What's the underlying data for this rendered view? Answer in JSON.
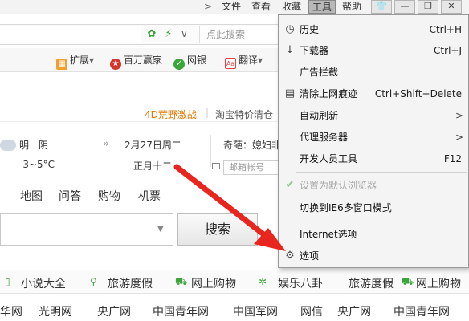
{
  "menubar": {
    "chev": ">",
    "items": [
      "文件",
      "查看",
      "收藏",
      "工具",
      "帮助"
    ],
    "active_index": 3
  },
  "addressbar": {
    "search_placeholder": "点此搜索",
    "dropdown": "∨"
  },
  "toolbar": {
    "items": [
      "扩展",
      "百万赢家",
      "网银",
      "翻译"
    ],
    "expand_arrow": "▾",
    "translate_arrow": "▾"
  },
  "content": {
    "promo_4d": "4D荒野激战",
    "promo_taobao": "淘宝特价清仓",
    "weather": {
      "condition": "明　阴",
      "temp": "-3~5°C",
      "date": "2月27日周二",
      "lunar": "正月十二",
      "quiz": "奇葩：媳妇非",
      "mail_placeholder": "邮箱帐号"
    },
    "nav": [
      "地图",
      "问答",
      "购物",
      "机票"
    ],
    "search_button": "搜索",
    "links": [
      "小说大全",
      "旅游度假",
      "网上购物",
      "娱乐八卦",
      "旅游度假",
      "网上购物"
    ],
    "sites": [
      "新华网",
      "光明网",
      "央广网",
      "中国青年网",
      "中国军网",
      "网信",
      "央广网",
      "中国青年网"
    ]
  },
  "dropdown": {
    "items": [
      {
        "label": "历史",
        "shortcut": "Ctrl+H",
        "icon": "clock-icon"
      },
      {
        "label": "下载器",
        "shortcut": "Ctrl+J",
        "icon": "download-icon"
      },
      {
        "label": "广告拦截",
        "shortcut": "",
        "icon": ""
      },
      {
        "label": "清除上网痕迹",
        "shortcut": "Ctrl+Shift+Delete",
        "icon": "clear-icon"
      },
      {
        "label": "自动刷新",
        "shortcut": "",
        "icon": "",
        "submenu": true
      },
      {
        "label": "代理服务器",
        "shortcut": "",
        "icon": "",
        "submenu": true
      },
      {
        "label": "开发人员工具",
        "shortcut": "F12",
        "icon": ""
      },
      {
        "label": "设置为默认浏览器",
        "shortcut": "",
        "icon": "check-icon",
        "disabled": true
      },
      {
        "label": "切换到IE6多窗口模式",
        "shortcut": "",
        "icon": ""
      },
      {
        "label": "Internet选项",
        "shortcut": "",
        "icon": ""
      },
      {
        "label": "选项",
        "shortcut": "",
        "icon": "gear-icon"
      }
    ],
    "submenu_arrow": ">"
  },
  "colors": {
    "arrow": "#e8261f",
    "accent_orange": "#e07800",
    "green": "#3aa63a"
  }
}
